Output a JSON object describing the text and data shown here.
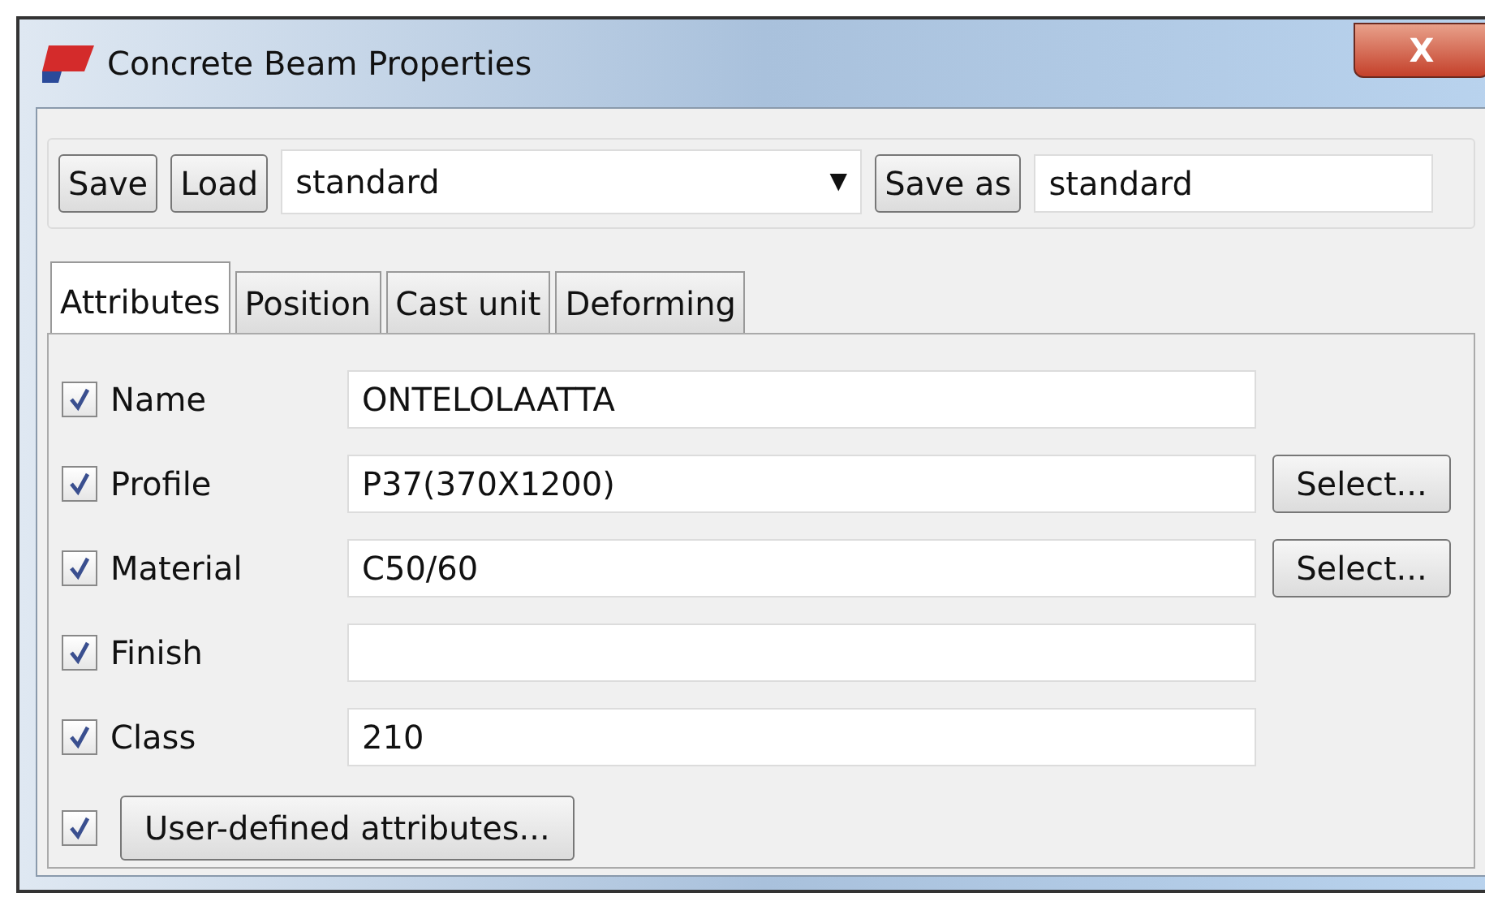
{
  "window": {
    "title": "Concrete Beam Properties",
    "close_label": "X"
  },
  "toolbar": {
    "save": "Save",
    "load": "Load",
    "preset": "standard",
    "dropdown_arrow": "▼",
    "save_as": "Save as",
    "save_as_name": "standard"
  },
  "tabs": [
    {
      "label": "Attributes",
      "selected": true
    },
    {
      "label": "Position",
      "selected": false
    },
    {
      "label": "Cast unit",
      "selected": false
    },
    {
      "label": "Deforming",
      "selected": false
    }
  ],
  "fields": [
    {
      "label": "Name",
      "checked": true,
      "value": "ONTELOLAATTA"
    },
    {
      "label": "Profile",
      "checked": true,
      "value": "P37(370X1200)",
      "button": "Select..."
    },
    {
      "label": "Material",
      "checked": true,
      "value": "C50/60",
      "button": "Select..."
    },
    {
      "label": "Finish",
      "checked": true
    },
    {
      "label": "Class",
      "checked": true,
      "value": "210"
    }
  ],
  "user_defined": {
    "checked": true,
    "button": "User-defined attributes..."
  }
}
